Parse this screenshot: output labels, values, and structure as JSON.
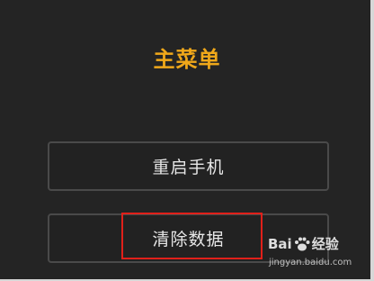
{
  "screen": {
    "title": "主菜单"
  },
  "menu": {
    "items": [
      {
        "label": "重启手机"
      },
      {
        "label": "清除数据"
      }
    ]
  },
  "watermark": {
    "brand_left": "Bai",
    "brand_right": "经验",
    "site": "jingyan.baidu.com"
  },
  "colors": {
    "background": "#242424",
    "title": "#f0a81a",
    "button_text": "#e6e6e6",
    "button_border": "#4a4a4a",
    "highlight": "#e0201a"
  }
}
